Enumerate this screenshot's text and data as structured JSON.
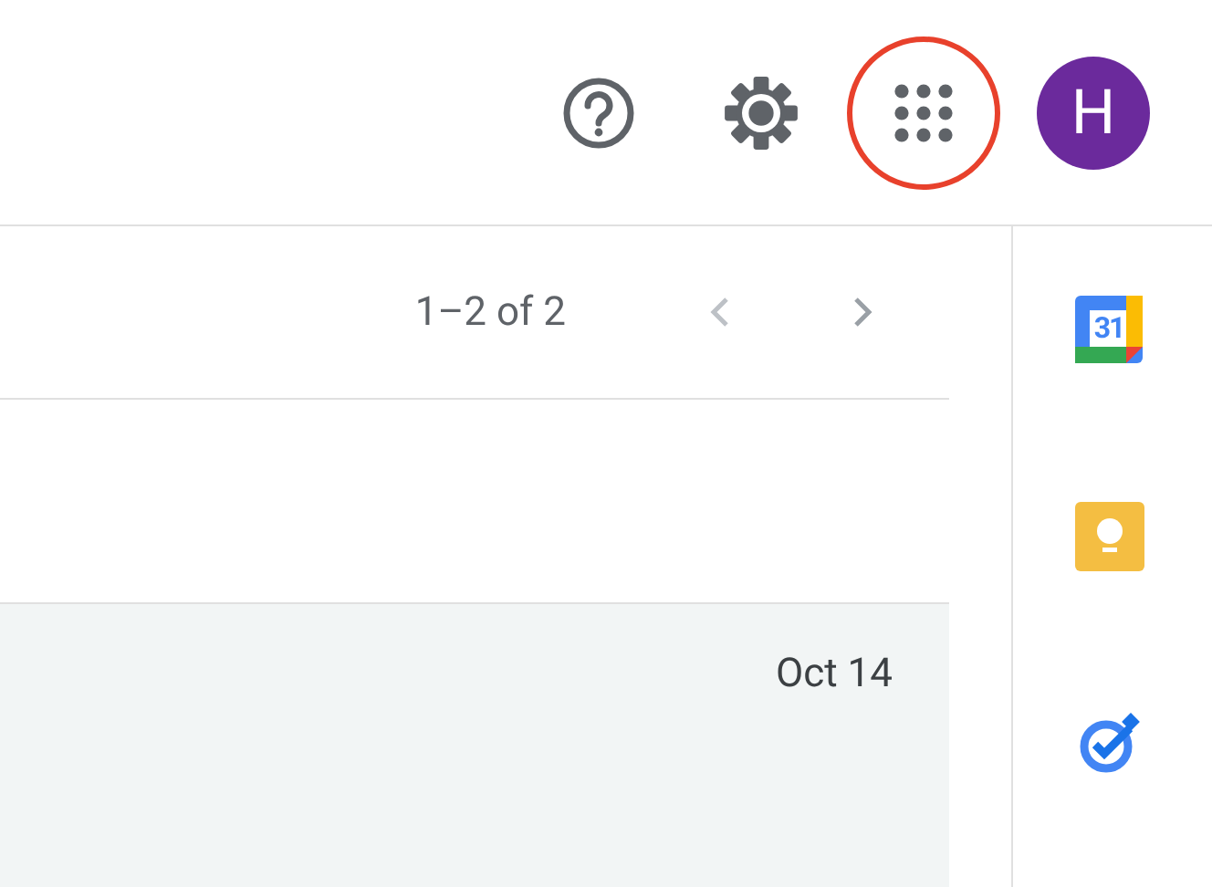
{
  "header": {
    "actions": [
      {
        "kind": "help",
        "highlighted": false
      },
      {
        "kind": "settings",
        "highlighted": false
      },
      {
        "kind": "apps",
        "highlighted": true
      }
    ],
    "avatar": {
      "letter": "H",
      "color": "#6b2a9c"
    }
  },
  "toolbar": {
    "pagination": "1–2 of 2",
    "prev_disabled": true,
    "next_disabled": false
  },
  "rows": [
    {
      "date": "Oct 14",
      "read": true
    }
  ],
  "side_panel": {
    "apps": [
      {
        "kind": "calendar",
        "label": "31"
      },
      {
        "kind": "keep"
      },
      {
        "kind": "tasks"
      }
    ]
  }
}
